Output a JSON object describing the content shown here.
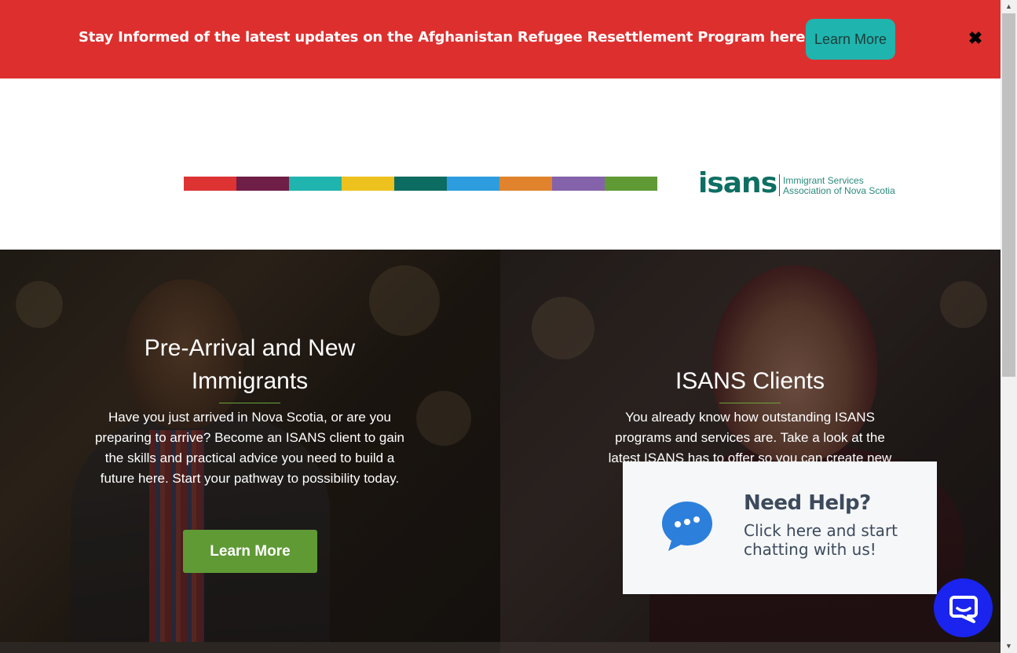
{
  "alert": {
    "text": "Stay Informed of the latest updates on the Afghanistan Refugee Resettlement Program here",
    "button_label": "Learn More",
    "close_glyph": "✖"
  },
  "header": {
    "color_bar": [
      "#dd3333",
      "#6e1e47",
      "#1fb4ad",
      "#eec21e",
      "#0d6c62",
      "#2d9ddf",
      "#e0832c",
      "#8563ab",
      "#5f9a35"
    ],
    "logo": {
      "mark": "isans",
      "line1": "Immigrant Services",
      "line2": "Association of Nova Scotia"
    }
  },
  "panels": [
    {
      "title": "Pre-Arrival and New Immigrants",
      "description": "Have you just arrived in Nova Scotia, or are you preparing to arrive? Become an ISANS client to gain the skills and practical advice you need to build a future here. Start your pathway to possibility today.",
      "button_label": "Learn More"
    },
    {
      "title": "ISANS Clients",
      "description": "You already know how outstanding ISANS programs and services are. Take a look at the latest ISANS has to offer so you can create new"
    }
  ],
  "help_popup": {
    "title": "Need Help?",
    "subtitle": "Click here and start chatting with us!",
    "icon": "chat-bubble-icon"
  },
  "colors": {
    "alert_bg": "#de2f2f",
    "alert_button": "#1fb4ad",
    "green_button": "#5f9a35",
    "chat_button": "#1a24ee",
    "logo_green": "#0e6e62"
  }
}
